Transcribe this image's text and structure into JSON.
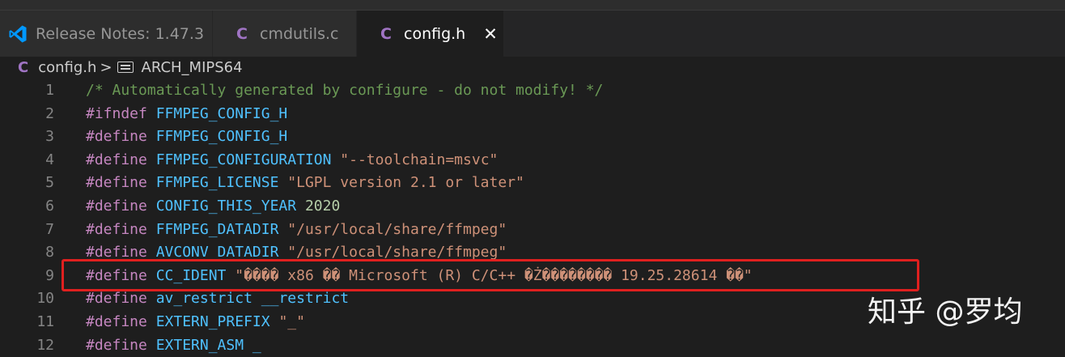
{
  "tabs": [
    {
      "label": "Release Notes: 1.47.3",
      "icon": "vscode-icon",
      "active": false
    },
    {
      "label": "cmdutils.c",
      "icon": "c-file-icon",
      "active": false
    },
    {
      "label": "config.h",
      "icon": "c-file-icon",
      "active": true
    }
  ],
  "tab_icon_letter": "C",
  "close_glyph": "✕",
  "breadcrumb": {
    "file": "config.h",
    "separator": ">",
    "symbol": "ARCH_MIPS64"
  },
  "lines": [
    {
      "n": "1",
      "tokens": [
        {
          "t": "comment",
          "v": "/* Automatically generated by configure - do not modify! */"
        }
      ]
    },
    {
      "n": "2",
      "tokens": [
        {
          "t": "kw",
          "v": "#ifndef"
        },
        {
          "t": "plain",
          "v": " "
        },
        {
          "t": "id",
          "v": "FFMPEG_CONFIG_H"
        }
      ]
    },
    {
      "n": "3",
      "tokens": [
        {
          "t": "kw",
          "v": "#define"
        },
        {
          "t": "plain",
          "v": " "
        },
        {
          "t": "id",
          "v": "FFMPEG_CONFIG_H"
        }
      ]
    },
    {
      "n": "4",
      "tokens": [
        {
          "t": "kw",
          "v": "#define"
        },
        {
          "t": "plain",
          "v": " "
        },
        {
          "t": "id",
          "v": "FFMPEG_CONFIGURATION"
        },
        {
          "t": "plain",
          "v": " "
        },
        {
          "t": "str",
          "v": "\"--toolchain=msvc\""
        }
      ]
    },
    {
      "n": "5",
      "tokens": [
        {
          "t": "kw",
          "v": "#define"
        },
        {
          "t": "plain",
          "v": " "
        },
        {
          "t": "id",
          "v": "FFMPEG_LICENSE"
        },
        {
          "t": "plain",
          "v": " "
        },
        {
          "t": "str",
          "v": "\"LGPL version 2.1 or later\""
        }
      ]
    },
    {
      "n": "6",
      "tokens": [
        {
          "t": "kw",
          "v": "#define"
        },
        {
          "t": "plain",
          "v": " "
        },
        {
          "t": "id",
          "v": "CONFIG_THIS_YEAR"
        },
        {
          "t": "plain",
          "v": " "
        },
        {
          "t": "num",
          "v": "2020"
        }
      ]
    },
    {
      "n": "7",
      "tokens": [
        {
          "t": "kw",
          "v": "#define"
        },
        {
          "t": "plain",
          "v": " "
        },
        {
          "t": "id",
          "v": "FFMPEG_DATADIR"
        },
        {
          "t": "plain",
          "v": " "
        },
        {
          "t": "str",
          "v": "\"/usr/local/share/ffmpeg\""
        }
      ]
    },
    {
      "n": "8",
      "tokens": [
        {
          "t": "kw",
          "v": "#define"
        },
        {
          "t": "plain",
          "v": " "
        },
        {
          "t": "id",
          "v": "AVCONV_DATADIR"
        },
        {
          "t": "plain",
          "v": " "
        },
        {
          "t": "str",
          "v": "\"/usr/local/share/ffmpeg\""
        }
      ]
    },
    {
      "n": "9",
      "tokens": [
        {
          "t": "kw",
          "v": "#define"
        },
        {
          "t": "plain",
          "v": " "
        },
        {
          "t": "id",
          "v": "CC_IDENT"
        },
        {
          "t": "plain",
          "v": " "
        },
        {
          "t": "str",
          "v": "\"���� x86 �� Microsoft (R) C/C++ �Ż�������� 19.25.28614 ��\""
        }
      ]
    },
    {
      "n": "10",
      "tokens": [
        {
          "t": "kw",
          "v": "#define"
        },
        {
          "t": "plain",
          "v": " "
        },
        {
          "t": "id",
          "v": "av_restrict"
        },
        {
          "t": "plain",
          "v": " "
        },
        {
          "t": "id",
          "v": "__restrict"
        }
      ]
    },
    {
      "n": "11",
      "tokens": [
        {
          "t": "kw",
          "v": "#define"
        },
        {
          "t": "plain",
          "v": " "
        },
        {
          "t": "id",
          "v": "EXTERN_PREFIX"
        },
        {
          "t": "plain",
          "v": " "
        },
        {
          "t": "str",
          "v": "\"_\""
        }
      ]
    },
    {
      "n": "12",
      "tokens": [
        {
          "t": "kw",
          "v": "#define"
        },
        {
          "t": "plain",
          "v": " "
        },
        {
          "t": "id",
          "v": "EXTERN_ASM"
        },
        {
          "t": "plain",
          "v": " "
        },
        {
          "t": "id",
          "v": "_"
        }
      ]
    }
  ],
  "watermark": "知乎 @罗均",
  "colors": {
    "editor_bg": "#1e1e1e",
    "highlight_box": "#e0201f",
    "keyword": "#c586c0",
    "identifier": "#4fc1ff",
    "string": "#ce9178",
    "comment": "#6a9955",
    "number": "#b5cea8"
  }
}
